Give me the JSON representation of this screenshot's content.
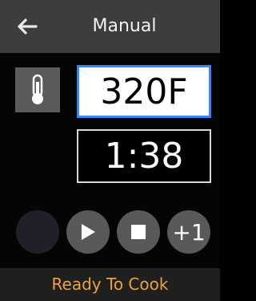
{
  "header": {
    "title": "Manual",
    "back_icon": "arrow-left-icon"
  },
  "temperature": {
    "icon": "thermometer-icon",
    "value": "320F"
  },
  "timer": {
    "value": "1:38"
  },
  "controls": {
    "unlabeled_icon": "blank-circle",
    "play_icon": "play-icon",
    "stop_icon": "stop-icon",
    "add_minute_label": "+1"
  },
  "status": {
    "text": "Ready To Cook",
    "color": "#f0a23a"
  },
  "colors": {
    "header_bg": "#3d3d3d",
    "accent_border": "#2f86ff",
    "button_bg": "#595959"
  }
}
